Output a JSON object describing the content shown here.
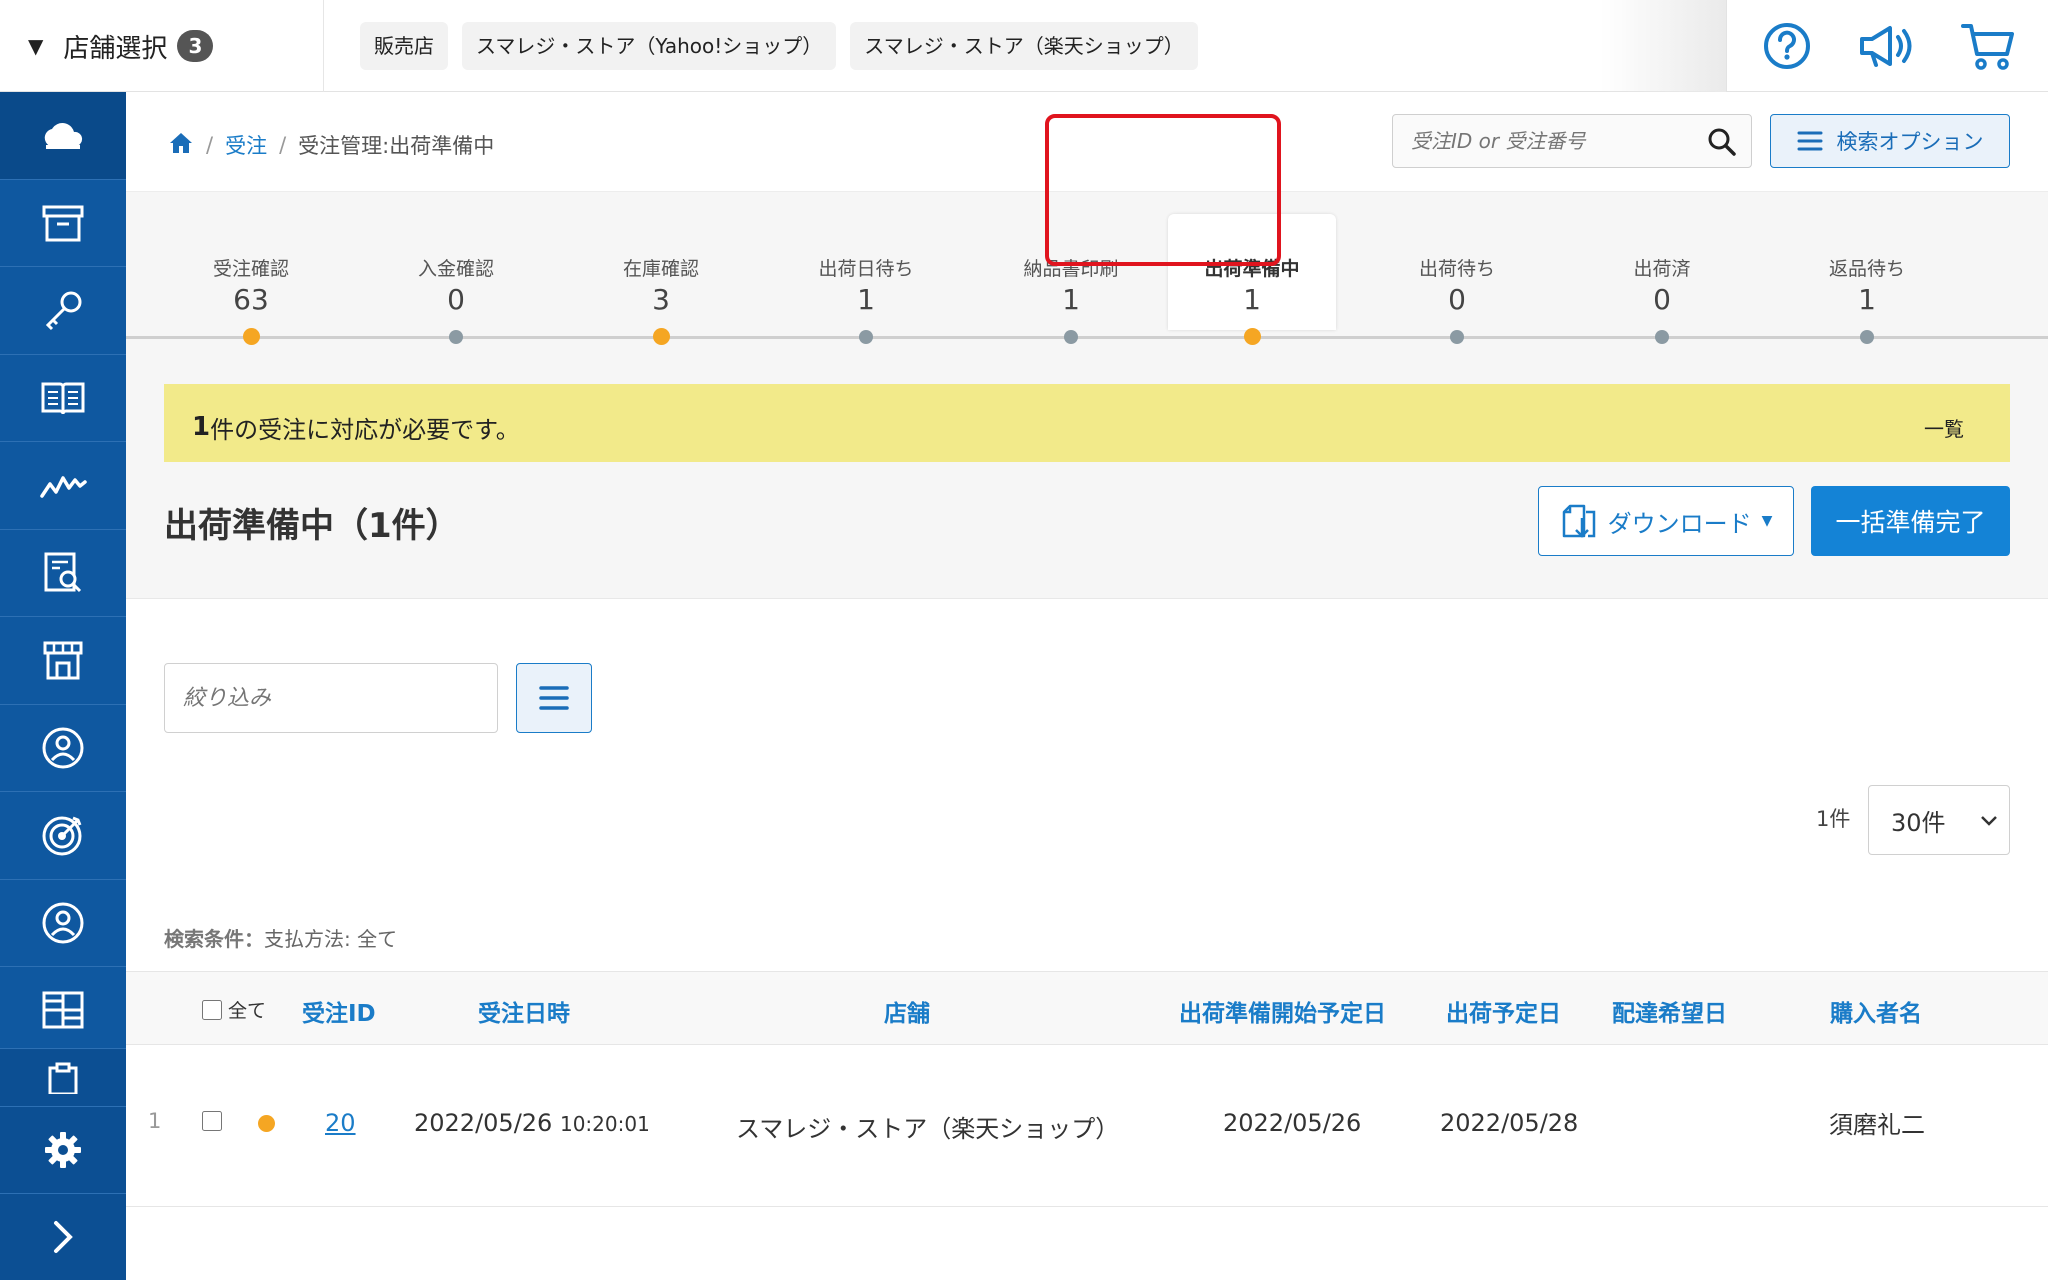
{
  "topbar": {
    "store_select_label": "店舗選択",
    "store_count": "3",
    "store_tags": [
      "販売店",
      "スマレジ・ストア（Yahoo!ショップ）",
      "スマレジ・ストア（楽天ショップ）"
    ]
  },
  "breadcrumb": {
    "level1": "受注",
    "level2": "受注管理:出荷準備中"
  },
  "search": {
    "placeholder": "受注ID or 受注番号",
    "options_label": "検索オプション"
  },
  "steps": [
    {
      "label": "受注確認",
      "count": "63",
      "status": "orange"
    },
    {
      "label": "入金確認",
      "count": "0",
      "status": "gray"
    },
    {
      "label": "在庫確認",
      "count": "3",
      "status": "orange"
    },
    {
      "label": "出荷日待ち",
      "count": "1",
      "status": "gray"
    },
    {
      "label": "納品書印刷",
      "count": "1",
      "status": "gray"
    },
    {
      "label": "出荷準備中",
      "count": "1",
      "status": "orange",
      "active": true
    },
    {
      "label": "出荷待ち",
      "count": "0",
      "status": "gray"
    },
    {
      "label": "出荷済",
      "count": "0",
      "status": "gray"
    },
    {
      "label": "返品待ち",
      "count": "1",
      "status": "gray"
    }
  ],
  "alert": {
    "count": "1",
    "message": "件の受注に対応が必要です。",
    "link": "一覧"
  },
  "page": {
    "title": "出荷準備中（1件）",
    "download_label": "ダウンロード",
    "complete_label": "一括準備完了"
  },
  "filter": {
    "placeholder": "絞り込み",
    "result_count": "1件",
    "per_page": "30件"
  },
  "conditions": {
    "label": "検索条件：",
    "value": "支払方法: 全て"
  },
  "table": {
    "select_all": "全て",
    "headers": {
      "id": "受注ID",
      "date": "受注日時",
      "store": "店舗",
      "prep_start": "出荷準備開始予定日",
      "ship_date": "出荷予定日",
      "delivery": "配達希望日",
      "buyer": "購入者名"
    },
    "rows": [
      {
        "num": "1",
        "id": "20",
        "date": "2022/05/26",
        "time": "10:20:01",
        "store": "スマレジ・ストア（楽天ショップ）",
        "prep_start": "2022/05/26",
        "ship_date": "2022/05/28",
        "delivery": "",
        "buyer": "須磨礼二"
      }
    ]
  },
  "colors": {
    "sidebar": "#0f58a0",
    "accent": "#1a7cc8",
    "status_orange": "#f5a623",
    "alert_bg": "#f2ea8a",
    "highlight": "#e0141e"
  }
}
